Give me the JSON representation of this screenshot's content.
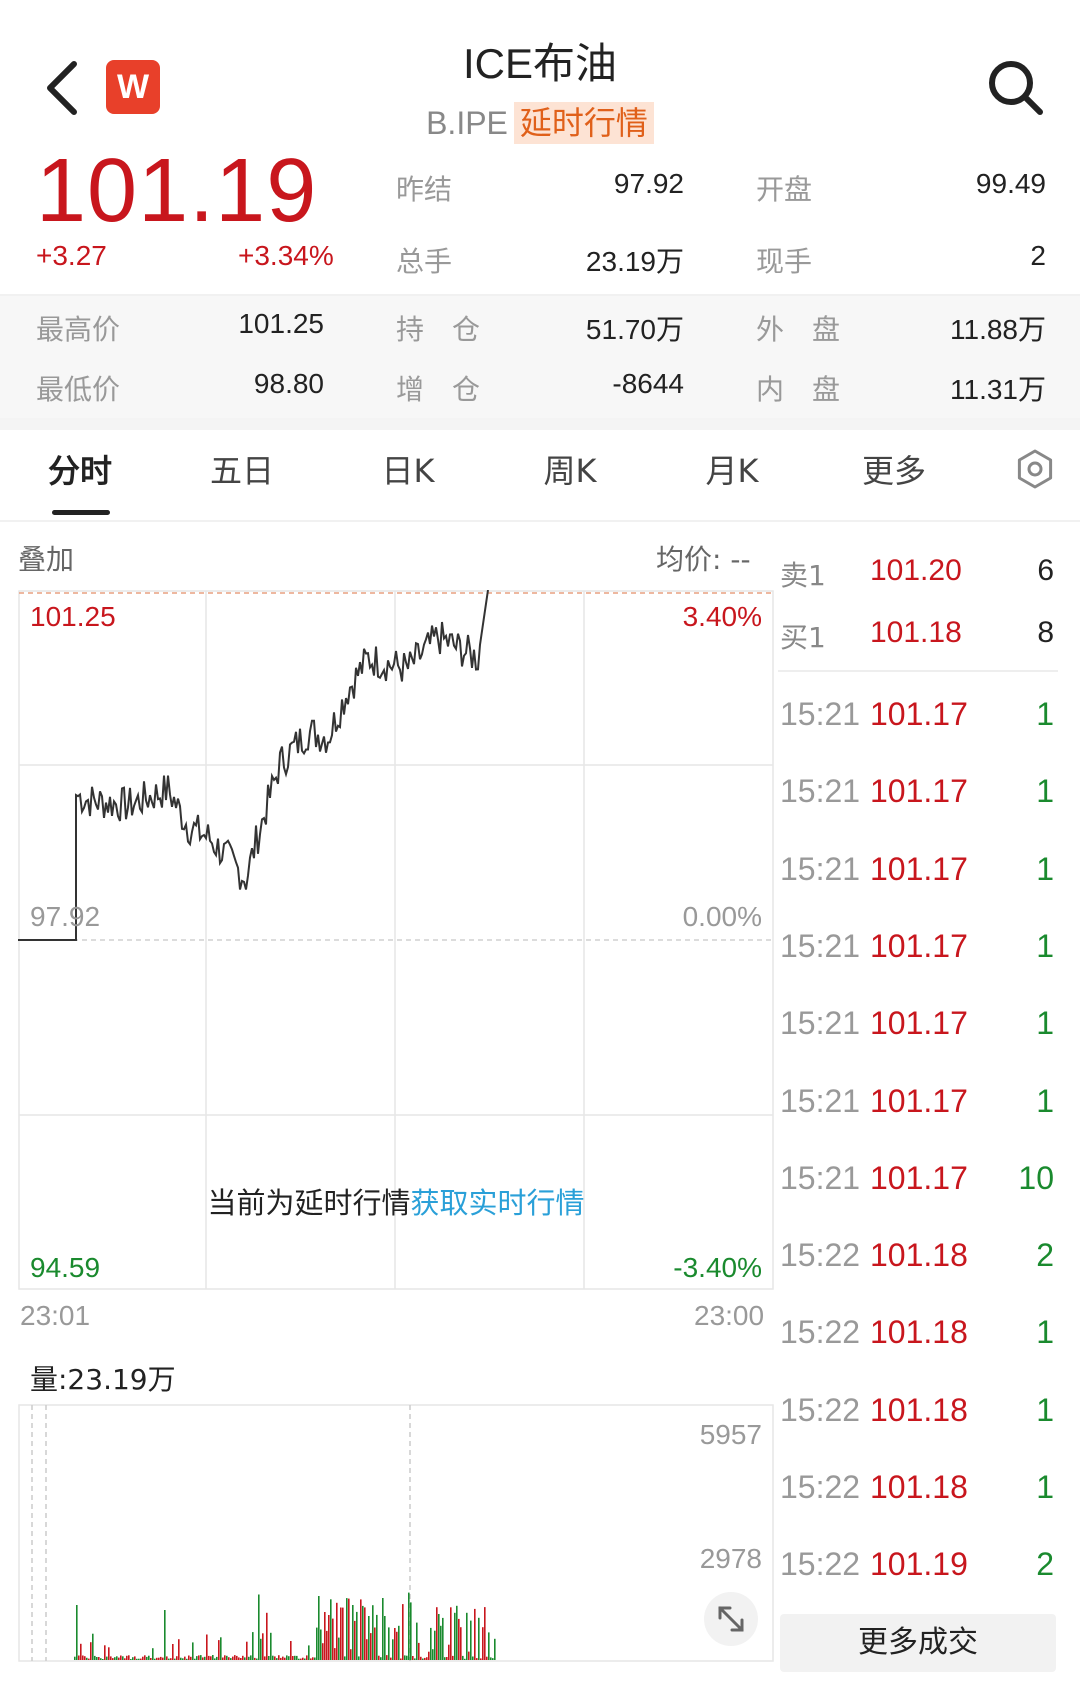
{
  "header": {
    "title": "ICE布油",
    "code": "B.IPE",
    "badge": "延时行情",
    "logo_letter": "W"
  },
  "quote": {
    "price": "101.19",
    "change": "+3.27",
    "change_pct": "+3.34%",
    "stats": [
      {
        "label": "昨结",
        "value": "97.92"
      },
      {
        "label": "开盘",
        "value": "99.49"
      },
      {
        "label": "总手",
        "value": "23.19万"
      },
      {
        "label": "现手",
        "value": "2"
      },
      {
        "label": "最高价",
        "value": "101.25"
      },
      {
        "label": "持　仓",
        "value": "51.70万"
      },
      {
        "label": "外　盘",
        "value": "11.88万"
      },
      {
        "label": "最低价",
        "value": "98.80"
      },
      {
        "label": "增　仓",
        "value": "-8644"
      },
      {
        "label": "内　盘",
        "value": "11.31万"
      }
    ]
  },
  "tabs": [
    "分时",
    "五日",
    "日K",
    "周K",
    "月K",
    "更多"
  ],
  "chart": {
    "overlay_label": "叠加",
    "avg_price_label": "均价: --",
    "delay_note": "当前为延时行情",
    "delay_link": "获取实时行情",
    "time_start": "23:01",
    "time_end": "23:00",
    "volume_label": "量:23.19万"
  },
  "chart_data": {
    "type": "line",
    "y_left_ticks": [
      "101.25",
      "97.92",
      "94.59"
    ],
    "y_right_ticks": [
      "3.40%",
      "0.00%",
      "-3.40%"
    ],
    "ylim": [
      94.59,
      101.25
    ],
    "prev_settle": 97.92,
    "x_ticks": [
      "23:01",
      "23:00"
    ],
    "volume_ticks": [
      "5957",
      "2978"
    ],
    "volume_max": 5957
  },
  "order_book": [
    {
      "label": "卖1",
      "price": "101.20",
      "qty": "6"
    },
    {
      "label": "买1",
      "price": "101.18",
      "qty": "8"
    }
  ],
  "trades": [
    {
      "time": "15:21",
      "price": "101.17",
      "qty": "1"
    },
    {
      "time": "15:21",
      "price": "101.17",
      "qty": "1"
    },
    {
      "time": "15:21",
      "price": "101.17",
      "qty": "1"
    },
    {
      "time": "15:21",
      "price": "101.17",
      "qty": "1"
    },
    {
      "time": "15:21",
      "price": "101.17",
      "qty": "1"
    },
    {
      "time": "15:21",
      "price": "101.17",
      "qty": "1"
    },
    {
      "time": "15:21",
      "price": "101.17",
      "qty": "10"
    },
    {
      "time": "15:22",
      "price": "101.18",
      "qty": "2"
    },
    {
      "time": "15:22",
      "price": "101.18",
      "qty": "1"
    },
    {
      "time": "15:22",
      "price": "101.18",
      "qty": "1"
    },
    {
      "time": "15:22",
      "price": "101.18",
      "qty": "1"
    },
    {
      "time": "15:22",
      "price": "101.19",
      "qty": "2"
    }
  ],
  "more_trades_label": "更多成交"
}
